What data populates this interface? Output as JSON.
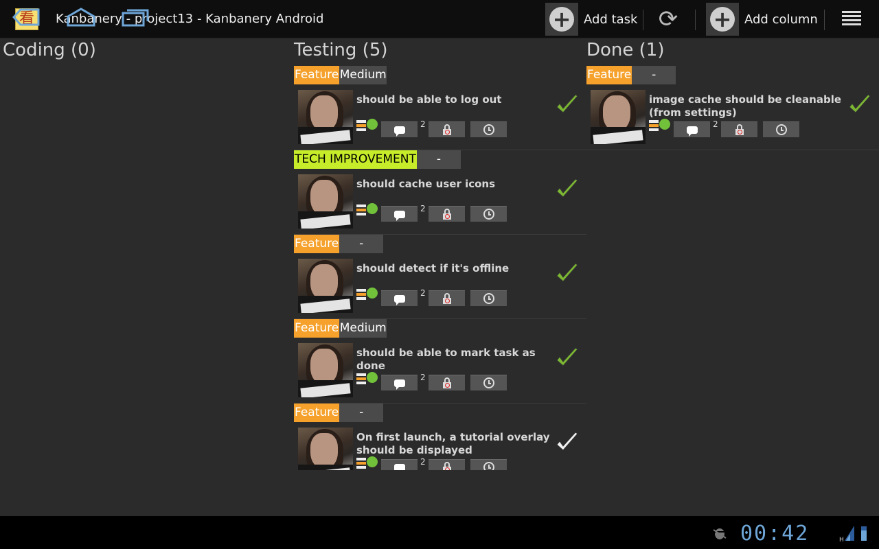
{
  "app": {
    "title": "Kanbanery - project13 - Kanbanery Android",
    "icon_glyph": "看"
  },
  "actionbar": {
    "add_task_label": "Add task",
    "add_column_label": "Add column"
  },
  "columns": {
    "coding": {
      "title": "Coding (0)"
    },
    "testing": {
      "title": "Testing (5)",
      "cards": [
        {
          "type": "Feature",
          "priority": "Medium",
          "title": "should be able to log out",
          "comments": "2",
          "done_check": "green"
        },
        {
          "type": "TECH IMPROVEMENT",
          "priority": "-",
          "title": "should cache user icons",
          "comments": "2",
          "done_check": "green"
        },
        {
          "type": "Feature",
          "priority": "-",
          "title": "should detect if it's offline",
          "comments": "2",
          "done_check": "green"
        },
        {
          "type": "Feature",
          "priority": "Medium",
          "title": "should be able to mark task as done",
          "comments": "2",
          "done_check": "green"
        },
        {
          "type": "Feature",
          "priority": "-",
          "title": "On first launch, a tutorial overlay should be displayed",
          "comments": "2",
          "done_check": "white"
        }
      ]
    },
    "done": {
      "title": "Done (1)",
      "cards": [
        {
          "type": "Feature",
          "priority": "-",
          "title": "image cache should be cleanable (from settings)",
          "comments": "2",
          "done_check": "green"
        }
      ]
    }
  },
  "statusbar": {
    "time": "00:42",
    "network_label": "H"
  },
  "colors": {
    "feature_tag": "#f5a12c",
    "tech_tag": "#c6ec2a",
    "check_green": "#7cb832",
    "clock_blue": "#6ea6d8"
  }
}
